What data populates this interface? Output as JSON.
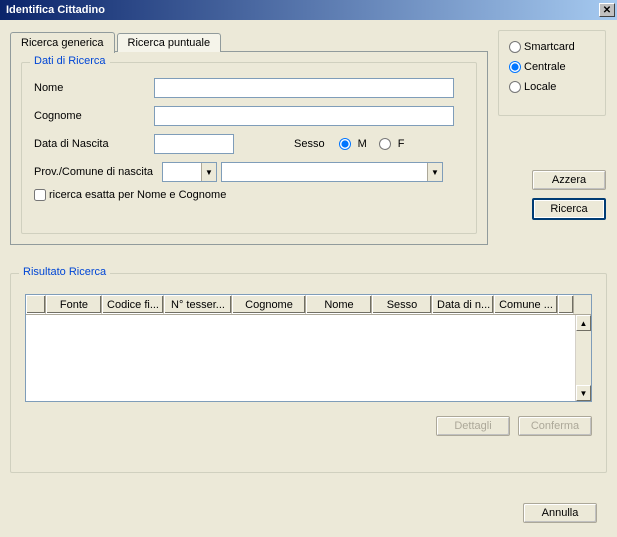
{
  "window": {
    "title": "Identifica Cittadino"
  },
  "tabs": {
    "generic": "Ricerca generica",
    "punctual": "Ricerca puntuale"
  },
  "search_group": {
    "legend": "Dati di Ricerca",
    "nome_label": "Nome",
    "cognome_label": "Cognome",
    "data_nascita_label": "Data di Nascita",
    "sesso_label": "Sesso",
    "sesso_m": "M",
    "sesso_f": "F",
    "prov_comune_label": "Prov./Comune di nascita",
    "exact_label": "ricerca esatta per Nome e Cognome",
    "nome_value": "",
    "cognome_value": "",
    "data_nascita_value": "",
    "prov_value": "",
    "comune_value": ""
  },
  "source": {
    "smartcard": "Smartcard",
    "centrale": "Centrale",
    "locale": "Locale",
    "selected": "centrale"
  },
  "buttons": {
    "azzera": "Azzera",
    "ricerca": "Ricerca",
    "dettagli": "Dettagli",
    "conferma": "Conferma",
    "annulla": "Annulla"
  },
  "result": {
    "legend": "Risultato Ricerca",
    "columns": [
      "",
      "Fonte",
      "Codice fi...",
      "N° tesser...",
      "Cognome",
      "Nome",
      "Sesso",
      "Data di n...",
      "Comune ..."
    ],
    "rows": []
  }
}
